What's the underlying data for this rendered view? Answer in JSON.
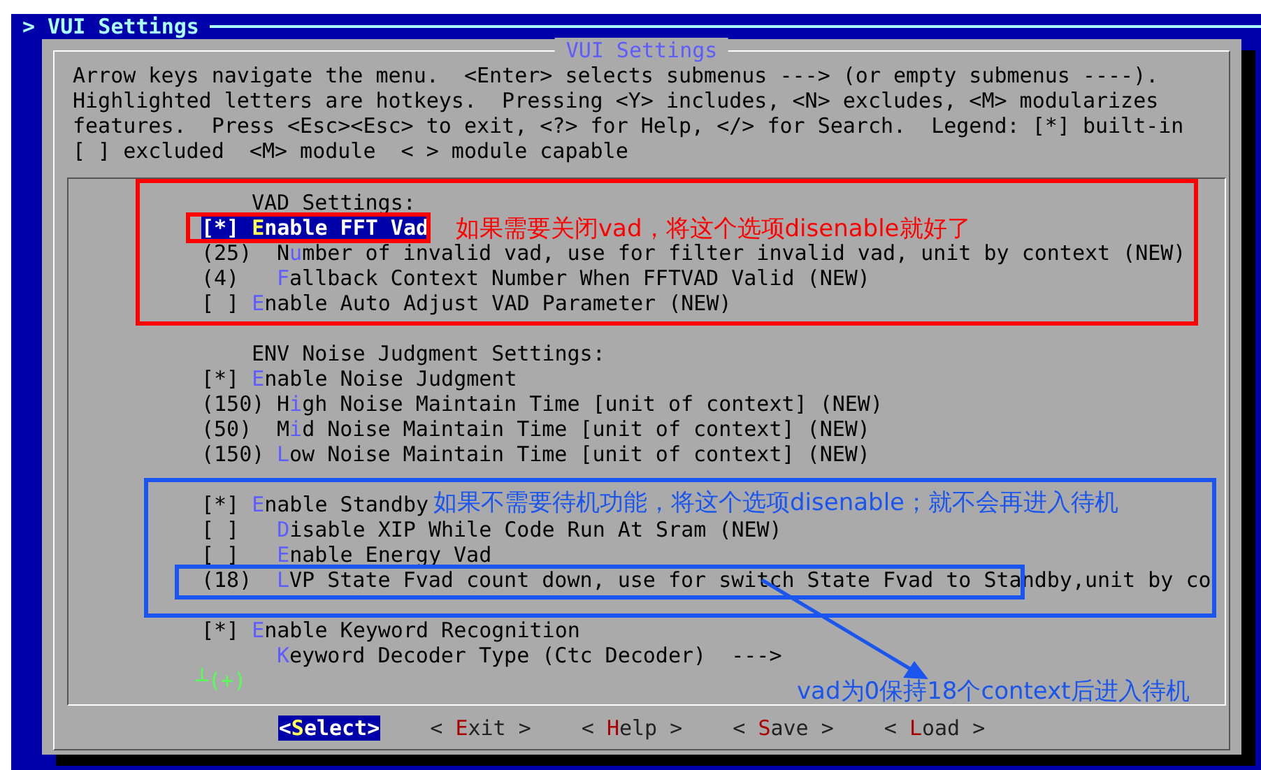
{
  "top_bar": {
    "title": "> VUI Settings"
  },
  "dialog": {
    "title": "VUI Settings",
    "help_lines": [
      "Arrow keys navigate the menu.  <Enter> selects submenus ---> (or empty submenus ----).",
      "Highlighted letters are hotkeys.  Pressing <Y> includes, <N> excludes, <M> modularizes",
      "features.  Press <Esc><Esc> to exit, <?> for Help, </> for Search.  Legend: [*] built-in",
      "[ ] excluded  <M> module  < > module capable"
    ],
    "menu": {
      "groups": [
        {
          "items": [
            {
              "kind": "heading",
              "text": "VAD Settings:",
              "selected": false
            },
            {
              "kind": "bool",
              "prefix": "[*]",
              "hotkey": "E",
              "rest": "nable FFT Vad",
              "selected": true
            },
            {
              "kind": "value",
              "prefix": "(25)",
              "lead": "N",
              "hotkey": "u",
              "rest": "mber of invalid vad, use for filter invalid vad, unit by context (NEW)",
              "selected": false
            },
            {
              "kind": "value",
              "prefix": "(4)",
              "hotkey": "F",
              "rest": "allback Context Number When FFTVAD Valid (NEW)",
              "selected": false
            },
            {
              "kind": "bool",
              "prefix": "[ ]",
              "hotkey": "E",
              "rest": "nable Auto Adjust VAD Parameter (NEW)",
              "selected": false
            }
          ]
        },
        {
          "items": [
            {
              "kind": "heading",
              "text": "ENV Noise Judgment Settings:",
              "selected": false
            },
            {
              "kind": "bool",
              "prefix": "[*]",
              "hotkey": "E",
              "rest": "nable Noise Judgment",
              "selected": false
            },
            {
              "kind": "value",
              "prefix": "(150)",
              "lead": "H",
              "hotkey": "i",
              "rest": "gh Noise Maintain Time [unit of context] (NEW)",
              "selected": false
            },
            {
              "kind": "value",
              "prefix": "(50)",
              "lead": "M",
              "hotkey": "i",
              "rest": "d Noise Maintain Time [unit of context] (NEW)",
              "selected": false
            },
            {
              "kind": "value",
              "prefix": "(150)",
              "hotkey": "L",
              "rest": "ow Noise Maintain Time [unit of context] (NEW)",
              "selected": false
            }
          ]
        },
        {
          "items": [
            {
              "kind": "bool",
              "prefix": "[*]",
              "hotkey": "E",
              "rest": "nable Standby",
              "selected": false,
              "children": [
                {
                  "kind": "bool",
                  "prefix": "[ ]",
                  "hotkey": "D",
                  "rest": "isable XIP While Code Run At Sram (NEW)",
                  "selected": false
                },
                {
                  "kind": "bool",
                  "prefix": "[ ]",
                  "hotkey": "E",
                  "rest": "nable Energy Vad",
                  "selected": false
                },
                {
                  "kind": "value",
                  "prefix": "(18)",
                  "hotkey": "L",
                  "rest": "VP State Fvad count down, use for switch State Fvad to Standby,unit by co",
                  "selected": false
                }
              ]
            }
          ]
        },
        {
          "items": [
            {
              "kind": "bool",
              "prefix": "[*]",
              "hotkey": "E",
              "rest": "nable Keyword Recognition",
              "selected": false,
              "children": [
                {
                  "kind": "submenu",
                  "hotkey": "K",
                  "rest": "eyword Decoder Type (Ctc Decoder)  --->",
                  "selected": false
                }
              ]
            }
          ]
        }
      ],
      "more_indicator": "┴(+)"
    },
    "buttons": [
      {
        "open": "<",
        "hotkey": "S",
        "rest": "elect",
        "close": ">",
        "selected": true
      },
      {
        "open": "< ",
        "hotkey": "E",
        "rest": "xit",
        "close": " >",
        "selected": false
      },
      {
        "open": "< ",
        "hotkey": "H",
        "rest": "elp",
        "close": " >",
        "selected": false
      },
      {
        "open": "< ",
        "hotkey": "S",
        "rest": "ave",
        "close": " >",
        "selected": false
      },
      {
        "open": "< ",
        "hotkey": "L",
        "rest": "oad",
        "close": " >",
        "selected": false
      }
    ]
  },
  "annotations": {
    "boxes": [
      {
        "color": "#ff0000"
      },
      {
        "color": "#ff0000"
      },
      {
        "color": "#1a55f0"
      },
      {
        "color": "#1a55f0"
      }
    ],
    "notes": [
      {
        "text": "如果需要关闭vad，将这个选项disenable就好了",
        "color": "#ff0000"
      },
      {
        "text": "如果不需要待机功能，将这个选项disenable；就不会再进入待机",
        "color": "#1a55f0"
      },
      {
        "text": "vad为0保持18个context后进入待机",
        "color": "#1a55f0"
      }
    ],
    "arrow": {
      "color": "#1a55f0"
    }
  }
}
